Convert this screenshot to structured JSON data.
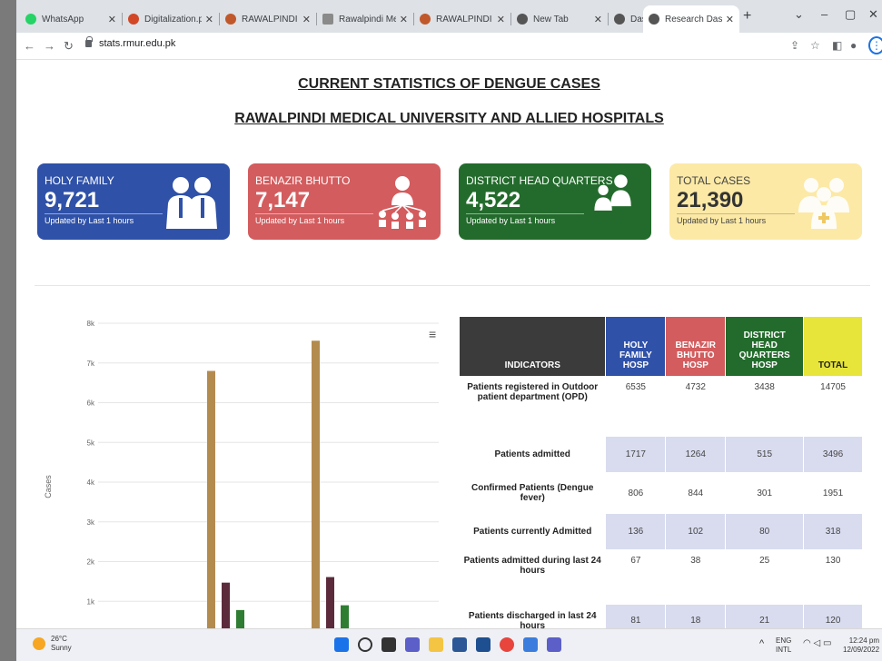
{
  "browser": {
    "tabs": [
      {
        "label": "WhatsApp",
        "color": "#25d366",
        "active": false
      },
      {
        "label": "Digitalization.ppt",
        "color": "#d24726",
        "active": false
      },
      {
        "label": "RAWALPINDI ME",
        "color": "#c0582b",
        "active": false
      },
      {
        "label": "Rawalpindi Medic",
        "color": "#8a8a8a",
        "active": false
      },
      {
        "label": "RAWALPINDI ME",
        "color": "#c0582b",
        "active": false
      },
      {
        "label": "New Tab",
        "color": "#555555",
        "active": false
      },
      {
        "label": "Dashboard",
        "color": "#555555",
        "active": false
      },
      {
        "label": "Research Dashbo",
        "color": "#555555",
        "active": true
      }
    ],
    "url": "stats.rmur.edu.pk"
  },
  "page": {
    "title1": "CURRENT STATISTICS OF DENGUE CASES",
    "title2": "RAWALPINDI MEDICAL UNIVERSITY AND ALLIED HOSPITALS"
  },
  "cards": [
    {
      "name": "HOLY FAMILY",
      "value": "9,721",
      "updated": "Updated by Last 1 hours",
      "color": "#2f51a8"
    },
    {
      "name": "BENAZIR BHUTTO",
      "value": "7,147",
      "updated": "Updated by Last 1 hours",
      "color": "#d35c5e"
    },
    {
      "name": "DISTRICT HEAD QUARTERS",
      "value": "4,522",
      "updated": "Updated by Last 1 hours",
      "color": "#236b2c"
    },
    {
      "name": "TOTAL CASES",
      "value": "21,390",
      "updated": "Updated by Last 1 hours",
      "color": "#fce9a6"
    }
  ],
  "chart_data": {
    "type": "bar",
    "ylabel": "Cases",
    "ylim": [
      0,
      8000
    ],
    "yticks": [
      "1k",
      "2k",
      "3k",
      "4k",
      "5k",
      "6k",
      "7k",
      "8k"
    ],
    "grid": true,
    "groups": [
      {
        "values": [
          6800,
          1470,
          780
        ]
      },
      {
        "values": [
          7560,
          1610,
          900
        ]
      }
    ],
    "series_colors": [
      "#b48b4f",
      "#5b2b3c",
      "#2e7d32"
    ]
  },
  "table": {
    "headers": [
      "INDICATORS",
      "HOLY FAMILY HOSP",
      "BENAZIR BHUTTO HOSP",
      "DISTRICT HEAD QUARTERS HOSP",
      "TOTAL"
    ],
    "rows": [
      {
        "indicator": "Patients registered in Outdoor patient department (OPD)",
        "hf": "6535",
        "bb": "4732",
        "dhq": "3438",
        "total": "14705"
      },
      {
        "indicator": "Patients admitted",
        "hf": "1717",
        "bb": "1264",
        "dhq": "515",
        "total": "3496"
      },
      {
        "indicator": "Confirmed Patients (Dengue fever)",
        "hf": "806",
        "bb": "844",
        "dhq": "301",
        "total": "1951"
      },
      {
        "indicator": "Patients currently Admitted",
        "hf": "136",
        "bb": "102",
        "dhq": "80",
        "total": "318"
      },
      {
        "indicator": "Patients admitted during last 24 hours",
        "hf": "67",
        "bb": "38",
        "dhq": "25",
        "total": "130"
      },
      {
        "indicator": "Patients discharged in last 24 hours",
        "hf": "81",
        "bb": "18",
        "dhq": "21",
        "total": "120"
      }
    ]
  },
  "taskbar": {
    "temp": "26°C",
    "weather": "Sunny",
    "lang1": "ENG",
    "lang2": "INTL",
    "time": "12:24 pm",
    "date": "12/09/2022"
  }
}
